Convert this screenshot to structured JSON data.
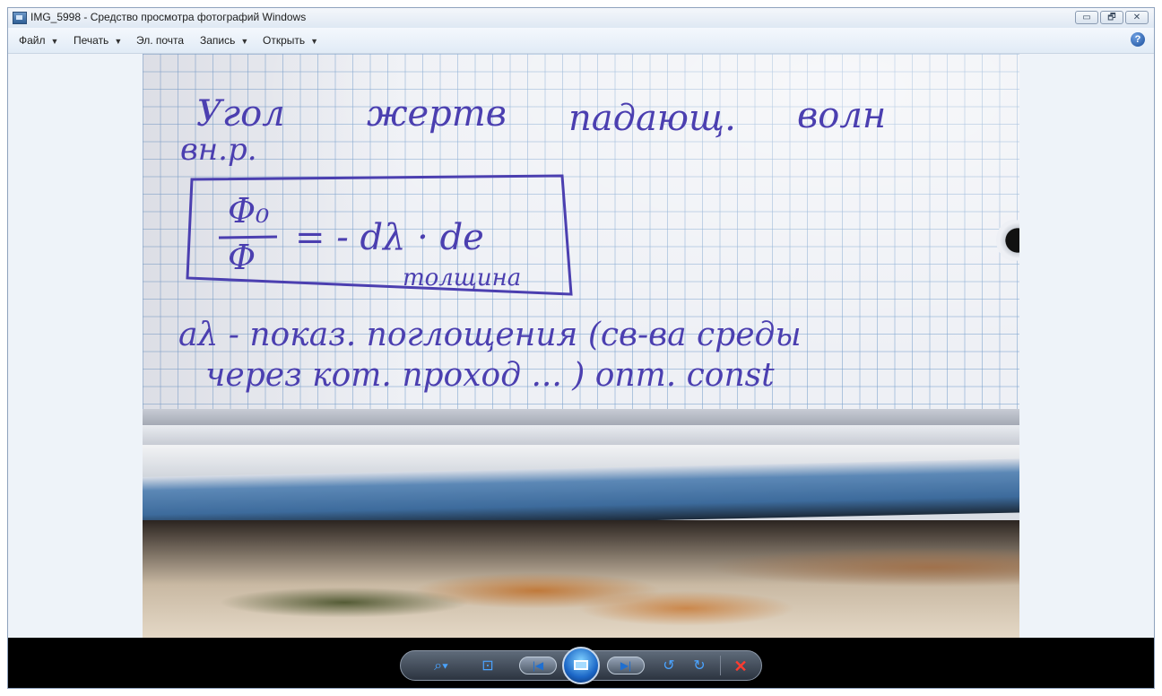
{
  "window": {
    "title": "IMG_5998 - Средство просмотра фотографий Windows",
    "app_icon": "photo-viewer-icon",
    "controls": {
      "minimize": "▭",
      "maximize": "🗗",
      "close": "✕"
    }
  },
  "menu": {
    "items": [
      {
        "label": "Файл",
        "has_dropdown": true
      },
      {
        "label": "Печать",
        "has_dropdown": true
      },
      {
        "label": "Эл. почта",
        "has_dropdown": false
      },
      {
        "label": "Запись",
        "has_dropdown": true
      },
      {
        "label": "Открыть",
        "has_dropdown": true
      }
    ],
    "help_symbol": "?"
  },
  "photo": {
    "handwriting": [
      "Угол",
      "жертв",
      "падающ.",
      "волн",
      "вн.р.",
      "Φ₀",
      "Φ",
      "= - dλ · de",
      "толщина",
      "aλ - показ. поглощения (св-ва среды",
      "через кот. проход ... ) опт. const"
    ]
  },
  "toolbar": {
    "zoom_icon": "⌕▾",
    "fit_icon": "⊡",
    "prev_icon": "|◀",
    "next_icon": "▶|",
    "rotate_ccw_icon": "↺",
    "rotate_cw_icon": "↻",
    "delete_icon": "✕"
  }
}
